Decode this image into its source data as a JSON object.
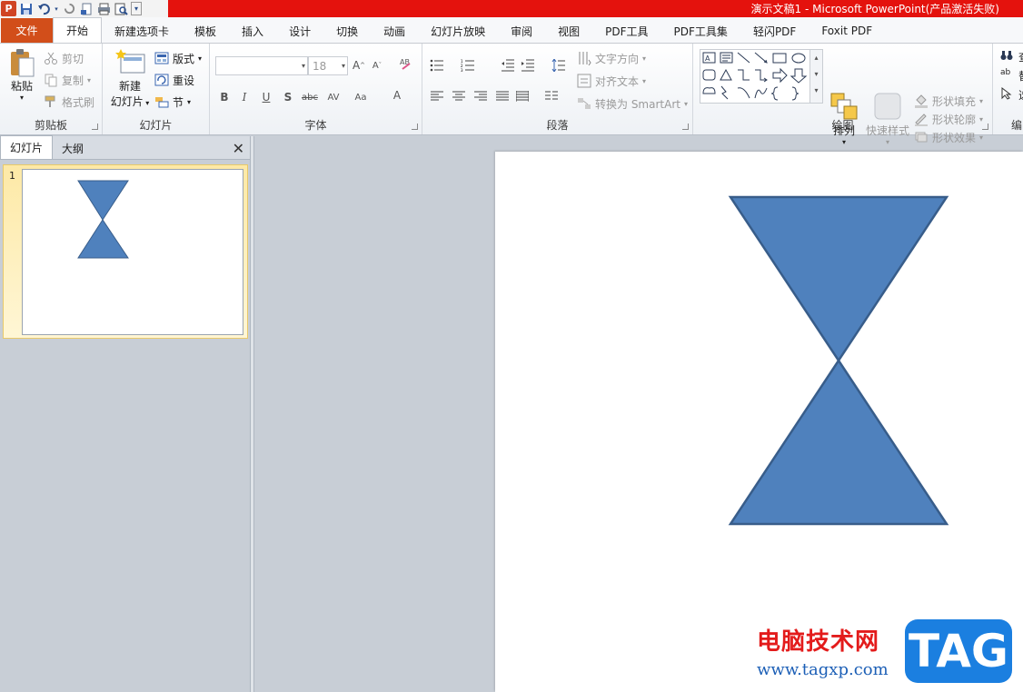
{
  "window": {
    "title": "演示文稿1  -  Microsoft PowerPoint(产品激活失败)"
  },
  "qat": {
    "app_letter": "P"
  },
  "tabs": [
    {
      "label": "文件"
    },
    {
      "label": "开始"
    },
    {
      "label": "新建选项卡"
    },
    {
      "label": "模板"
    },
    {
      "label": "插入"
    },
    {
      "label": "设计"
    },
    {
      "label": "切换"
    },
    {
      "label": "动画"
    },
    {
      "label": "幻灯片放映"
    },
    {
      "label": "审阅"
    },
    {
      "label": "视图"
    },
    {
      "label": "PDF工具"
    },
    {
      "label": "PDF工具集"
    },
    {
      "label": "轻闪PDF"
    },
    {
      "label": "Foxit PDF"
    }
  ],
  "ribbon": {
    "clipboard": {
      "group": "剪贴板",
      "paste": "粘贴",
      "cut": "剪切",
      "copy": "复制",
      "format_painter": "格式刷"
    },
    "slides": {
      "group": "幻灯片",
      "new_slide_line1": "新建",
      "new_slide_line2": "幻灯片",
      "layout": "版式",
      "reset": "重设",
      "section": "节"
    },
    "font": {
      "group": "字体",
      "font_name": "",
      "font_size": "18"
    },
    "paragraph": {
      "group": "段落",
      "text_direction": "文字方向",
      "align_text": "对齐文本",
      "convert_smartart": "转换为 SmartArt"
    },
    "drawing": {
      "group": "绘图",
      "arrange": "排列",
      "quick_styles": "快速样式",
      "shape_fill": "形状填充",
      "shape_outline": "形状轮廓",
      "shape_effects": "形状效果"
    },
    "editing": {
      "group": "编",
      "find": "查",
      "replace": "替",
      "select": "选"
    }
  },
  "pane": {
    "tab_slides": "幻灯片",
    "tab_outline": "大纲",
    "close": "✕",
    "slide_number": "1"
  },
  "slide": {
    "shape": "hourglass",
    "fill_color": "#4f81bd",
    "outline_color": "#385d8a"
  },
  "watermark": {
    "text": "电脑技术网",
    "url": "www.tagxp.com",
    "logo": "TAG"
  }
}
